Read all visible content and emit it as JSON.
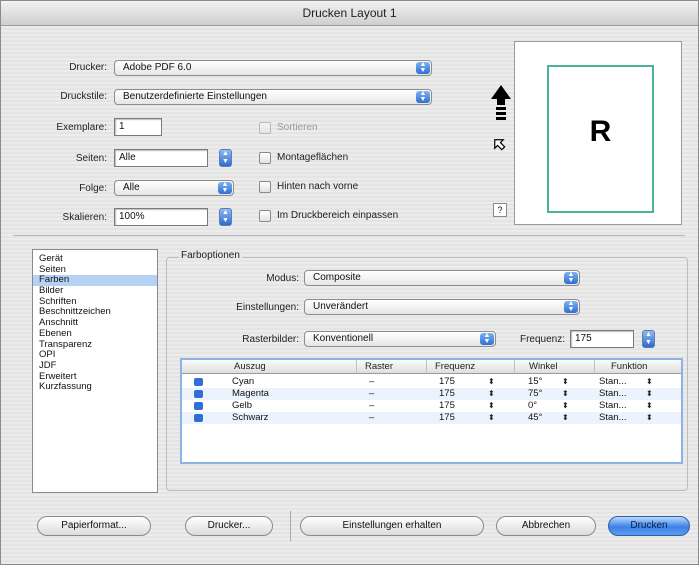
{
  "window": {
    "title": "Drucken Layout 1"
  },
  "form": {
    "printer_label": "Drucker:",
    "printer_value": "Adobe PDF 6.0",
    "style_label": "Druckstile:",
    "style_value": "Benutzerdefinierte Einstellungen",
    "copies_label": "Exemplare:",
    "copies_value": "1",
    "pages_label": "Seiten:",
    "pages_value": "Alle",
    "sequence_label": "Folge:",
    "sequence_value": "Alle",
    "scale_label": "Skalieren:",
    "scale_value": "100%"
  },
  "options": {
    "collate": "Sortieren",
    "spreads": "Montageflächen",
    "back_to_front": "Hinten nach vorne",
    "fit_to_area": "Im Druckbereich einpassen"
  },
  "preview": {
    "letter": "R",
    "help": "?"
  },
  "categories": [
    "Gerät",
    "Seiten",
    "Farben",
    "Bilder",
    "Schriften",
    "Beschnittzeichen",
    "Anschnitt",
    "Ebenen",
    "Transparenz",
    "OPI",
    "JDF",
    "Erweitert",
    "Kurzfassung"
  ],
  "selected_category": 2,
  "color_options": {
    "group_title": "Farboptionen",
    "mode_label": "Modus:",
    "mode_value": "Composite",
    "settings_label": "Einstellungen:",
    "settings_value": "Unverändert",
    "raster_label": "Rasterbilder:",
    "raster_value": "Konventionell",
    "freq_label": "Frequenz:",
    "freq_value": "175"
  },
  "table": {
    "headers": [
      "Auszug",
      "Raster",
      "Frequenz",
      "Winkel",
      "Funktion"
    ],
    "rows": [
      {
        "name": "Cyan",
        "raster": "–",
        "freq": "175",
        "angle": "15°",
        "func": "Stan..."
      },
      {
        "name": "Magenta",
        "raster": "–",
        "freq": "175",
        "angle": "75°",
        "func": "Stan..."
      },
      {
        "name": "Gelb",
        "raster": "–",
        "freq": "175",
        "angle": "0°",
        "func": "Stan..."
      },
      {
        "name": "Schwarz",
        "raster": "–",
        "freq": "175",
        "angle": "45°",
        "func": "Stan..."
      }
    ]
  },
  "buttons": {
    "paper_format": "Papierformat...",
    "printer": "Drucker...",
    "keep_settings": "Einstellungen erhalten",
    "cancel": "Abbrechen",
    "print": "Drucken"
  }
}
